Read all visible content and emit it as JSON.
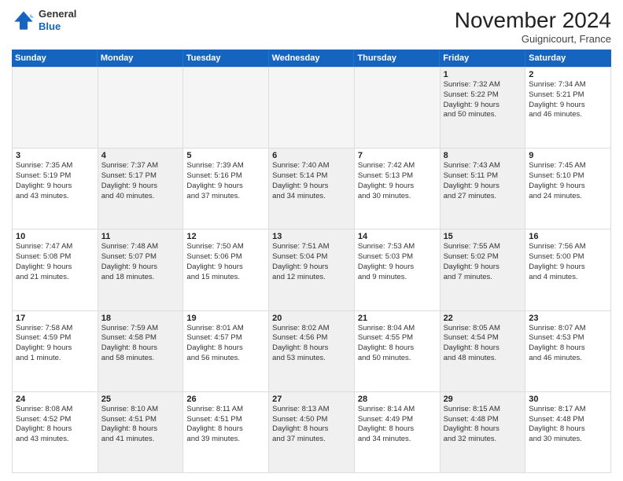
{
  "header": {
    "logo_general": "General",
    "logo_blue": "Blue",
    "month": "November 2024",
    "location": "Guignicourt, France"
  },
  "weekdays": [
    "Sunday",
    "Monday",
    "Tuesday",
    "Wednesday",
    "Thursday",
    "Friday",
    "Saturday"
  ],
  "weeks": [
    [
      {
        "day": "",
        "info": [],
        "empty": true
      },
      {
        "day": "",
        "info": [],
        "empty": true
      },
      {
        "day": "",
        "info": [],
        "empty": true
      },
      {
        "day": "",
        "info": [],
        "empty": true
      },
      {
        "day": "",
        "info": [],
        "empty": true
      },
      {
        "day": "1",
        "info": [
          "Sunrise: 7:32 AM",
          "Sunset: 5:22 PM",
          "Daylight: 9 hours",
          "and 50 minutes."
        ],
        "empty": false,
        "shaded": true
      },
      {
        "day": "2",
        "info": [
          "Sunrise: 7:34 AM",
          "Sunset: 5:21 PM",
          "Daylight: 9 hours",
          "and 46 minutes."
        ],
        "empty": false,
        "shaded": false
      }
    ],
    [
      {
        "day": "3",
        "info": [
          "Sunrise: 7:35 AM",
          "Sunset: 5:19 PM",
          "Daylight: 9 hours",
          "and 43 minutes."
        ],
        "empty": false,
        "shaded": false
      },
      {
        "day": "4",
        "info": [
          "Sunrise: 7:37 AM",
          "Sunset: 5:17 PM",
          "Daylight: 9 hours",
          "and 40 minutes."
        ],
        "empty": false,
        "shaded": true
      },
      {
        "day": "5",
        "info": [
          "Sunrise: 7:39 AM",
          "Sunset: 5:16 PM",
          "Daylight: 9 hours",
          "and 37 minutes."
        ],
        "empty": false,
        "shaded": false
      },
      {
        "day": "6",
        "info": [
          "Sunrise: 7:40 AM",
          "Sunset: 5:14 PM",
          "Daylight: 9 hours",
          "and 34 minutes."
        ],
        "empty": false,
        "shaded": true
      },
      {
        "day": "7",
        "info": [
          "Sunrise: 7:42 AM",
          "Sunset: 5:13 PM",
          "Daylight: 9 hours",
          "and 30 minutes."
        ],
        "empty": false,
        "shaded": false
      },
      {
        "day": "8",
        "info": [
          "Sunrise: 7:43 AM",
          "Sunset: 5:11 PM",
          "Daylight: 9 hours",
          "and 27 minutes."
        ],
        "empty": false,
        "shaded": true
      },
      {
        "day": "9",
        "info": [
          "Sunrise: 7:45 AM",
          "Sunset: 5:10 PM",
          "Daylight: 9 hours",
          "and 24 minutes."
        ],
        "empty": false,
        "shaded": false
      }
    ],
    [
      {
        "day": "10",
        "info": [
          "Sunrise: 7:47 AM",
          "Sunset: 5:08 PM",
          "Daylight: 9 hours",
          "and 21 minutes."
        ],
        "empty": false,
        "shaded": false
      },
      {
        "day": "11",
        "info": [
          "Sunrise: 7:48 AM",
          "Sunset: 5:07 PM",
          "Daylight: 9 hours",
          "and 18 minutes."
        ],
        "empty": false,
        "shaded": true
      },
      {
        "day": "12",
        "info": [
          "Sunrise: 7:50 AM",
          "Sunset: 5:06 PM",
          "Daylight: 9 hours",
          "and 15 minutes."
        ],
        "empty": false,
        "shaded": false
      },
      {
        "day": "13",
        "info": [
          "Sunrise: 7:51 AM",
          "Sunset: 5:04 PM",
          "Daylight: 9 hours",
          "and 12 minutes."
        ],
        "empty": false,
        "shaded": true
      },
      {
        "day": "14",
        "info": [
          "Sunrise: 7:53 AM",
          "Sunset: 5:03 PM",
          "Daylight: 9 hours",
          "and 9 minutes."
        ],
        "empty": false,
        "shaded": false
      },
      {
        "day": "15",
        "info": [
          "Sunrise: 7:55 AM",
          "Sunset: 5:02 PM",
          "Daylight: 9 hours",
          "and 7 minutes."
        ],
        "empty": false,
        "shaded": true
      },
      {
        "day": "16",
        "info": [
          "Sunrise: 7:56 AM",
          "Sunset: 5:00 PM",
          "Daylight: 9 hours",
          "and 4 minutes."
        ],
        "empty": false,
        "shaded": false
      }
    ],
    [
      {
        "day": "17",
        "info": [
          "Sunrise: 7:58 AM",
          "Sunset: 4:59 PM",
          "Daylight: 9 hours",
          "and 1 minute."
        ],
        "empty": false,
        "shaded": false
      },
      {
        "day": "18",
        "info": [
          "Sunrise: 7:59 AM",
          "Sunset: 4:58 PM",
          "Daylight: 8 hours",
          "and 58 minutes."
        ],
        "empty": false,
        "shaded": true
      },
      {
        "day": "19",
        "info": [
          "Sunrise: 8:01 AM",
          "Sunset: 4:57 PM",
          "Daylight: 8 hours",
          "and 56 minutes."
        ],
        "empty": false,
        "shaded": false
      },
      {
        "day": "20",
        "info": [
          "Sunrise: 8:02 AM",
          "Sunset: 4:56 PM",
          "Daylight: 8 hours",
          "and 53 minutes."
        ],
        "empty": false,
        "shaded": true
      },
      {
        "day": "21",
        "info": [
          "Sunrise: 8:04 AM",
          "Sunset: 4:55 PM",
          "Daylight: 8 hours",
          "and 50 minutes."
        ],
        "empty": false,
        "shaded": false
      },
      {
        "day": "22",
        "info": [
          "Sunrise: 8:05 AM",
          "Sunset: 4:54 PM",
          "Daylight: 8 hours",
          "and 48 minutes."
        ],
        "empty": false,
        "shaded": true
      },
      {
        "day": "23",
        "info": [
          "Sunrise: 8:07 AM",
          "Sunset: 4:53 PM",
          "Daylight: 8 hours",
          "and 46 minutes."
        ],
        "empty": false,
        "shaded": false
      }
    ],
    [
      {
        "day": "24",
        "info": [
          "Sunrise: 8:08 AM",
          "Sunset: 4:52 PM",
          "Daylight: 8 hours",
          "and 43 minutes."
        ],
        "empty": false,
        "shaded": false
      },
      {
        "day": "25",
        "info": [
          "Sunrise: 8:10 AM",
          "Sunset: 4:51 PM",
          "Daylight: 8 hours",
          "and 41 minutes."
        ],
        "empty": false,
        "shaded": true
      },
      {
        "day": "26",
        "info": [
          "Sunrise: 8:11 AM",
          "Sunset: 4:51 PM",
          "Daylight: 8 hours",
          "and 39 minutes."
        ],
        "empty": false,
        "shaded": false
      },
      {
        "day": "27",
        "info": [
          "Sunrise: 8:13 AM",
          "Sunset: 4:50 PM",
          "Daylight: 8 hours",
          "and 37 minutes."
        ],
        "empty": false,
        "shaded": true
      },
      {
        "day": "28",
        "info": [
          "Sunrise: 8:14 AM",
          "Sunset: 4:49 PM",
          "Daylight: 8 hours",
          "and 34 minutes."
        ],
        "empty": false,
        "shaded": false
      },
      {
        "day": "29",
        "info": [
          "Sunrise: 8:15 AM",
          "Sunset: 4:48 PM",
          "Daylight: 8 hours",
          "and 32 minutes."
        ],
        "empty": false,
        "shaded": true
      },
      {
        "day": "30",
        "info": [
          "Sunrise: 8:17 AM",
          "Sunset: 4:48 PM",
          "Daylight: 8 hours",
          "and 30 minutes."
        ],
        "empty": false,
        "shaded": false
      }
    ]
  ]
}
